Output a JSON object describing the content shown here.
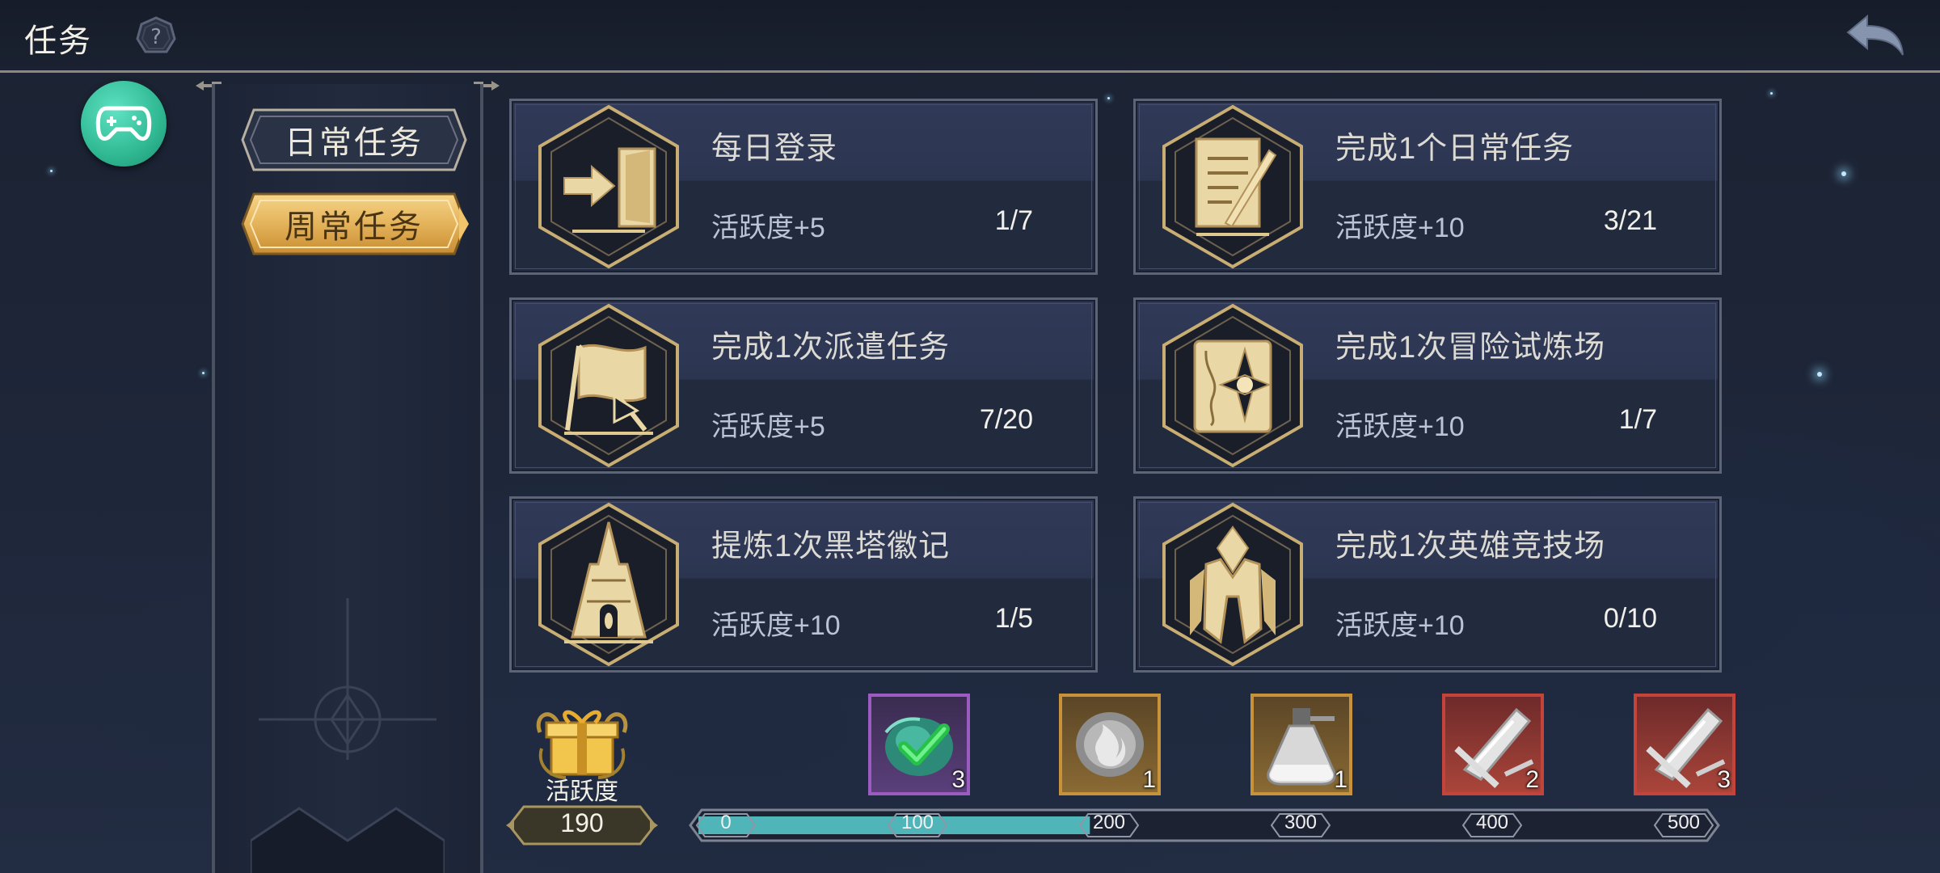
{
  "header": {
    "title": "任务",
    "help_icon": "question-mark-icon",
    "back_icon": "back-arrow-icon"
  },
  "sidebar": {
    "gamepad_icon": "gamepad-icon",
    "tabs": [
      {
        "label": "日常任务",
        "active": false
      },
      {
        "label": "周常任务",
        "active": true
      }
    ]
  },
  "tasks": [
    {
      "title": "每日登录",
      "reward": "活跃度+5",
      "progress": "1/7",
      "icon": "door-enter-icon"
    },
    {
      "title": "完成1个日常任务",
      "reward": "活跃度+10",
      "progress": "3/21",
      "icon": "scroll-quill-icon"
    },
    {
      "title": "完成1次派遣任务",
      "reward": "活跃度+5",
      "progress": "7/20",
      "icon": "banner-flag-icon"
    },
    {
      "title": "完成1次冒险试炼场",
      "reward": "活跃度+10",
      "progress": "1/7",
      "icon": "compass-book-icon"
    },
    {
      "title": "提炼1次黑塔徽记",
      "reward": "活跃度+10",
      "progress": "1/5",
      "icon": "black-tower-icon"
    },
    {
      "title": "完成1次英雄竞技场",
      "reward": "活跃度+10",
      "progress": "0/10",
      "icon": "hero-armor-icon"
    }
  ],
  "activity": {
    "label": "活跃度",
    "value": "190",
    "max": 500,
    "current": 190,
    "ticks": [
      "0",
      "100",
      "200",
      "300",
      "400",
      "500"
    ],
    "rewards": [
      {
        "count": "3",
        "icon": "green-gem-icon",
        "claimed": true,
        "rarity_color": "#9b5bc0"
      },
      {
        "count": "1",
        "icon": "fire-stone-icon",
        "claimed": false,
        "rarity_color": "#c8923a"
      },
      {
        "count": "1",
        "icon": "potion-bottle-icon",
        "claimed": false,
        "rarity_color": "#c8923a"
      },
      {
        "count": "2",
        "icon": "crystal-shard-icon",
        "claimed": false,
        "rarity_color": "#c4433a"
      },
      {
        "count": "3",
        "icon": "crystal-shard-icon",
        "claimed": false,
        "rarity_color": "#c4433a"
      }
    ]
  },
  "colors": {
    "accent_gold": "#d8b265",
    "progress_fill": "#4fb5b8",
    "card_border": "#5c6477"
  }
}
